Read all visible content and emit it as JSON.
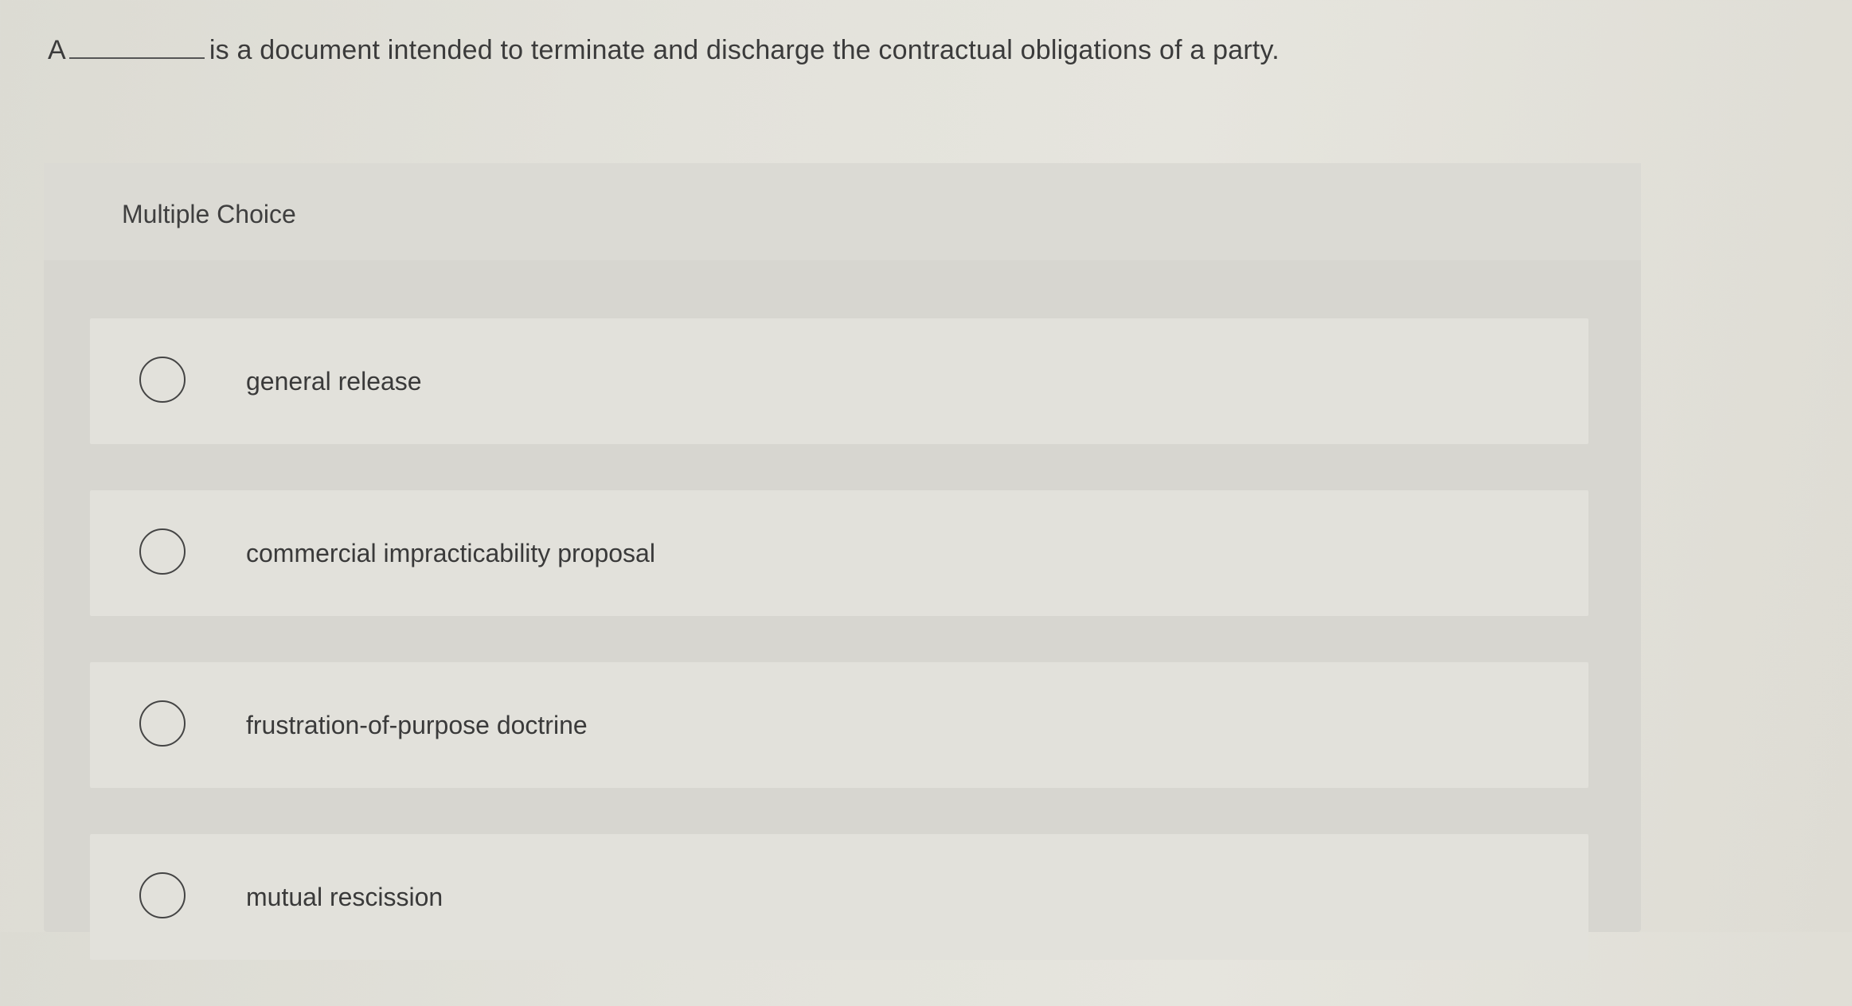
{
  "question": {
    "prefix": "A",
    "text": "is a document intended to terminate and discharge the contractual obligations of a party."
  },
  "multiple_choice": {
    "title": "Multiple Choice",
    "options": [
      {
        "label": "general release",
        "selected": false
      },
      {
        "label": "commercial impracticability proposal",
        "selected": false
      },
      {
        "label": "frustration-of-purpose doctrine",
        "selected": false
      },
      {
        "label": "mutual rescission",
        "selected": false
      }
    ]
  },
  "colors": {
    "background": "#e3e2db",
    "panel": "#d7d6d0",
    "option_row": "#e2e1db",
    "text": "#3b3b3b"
  }
}
